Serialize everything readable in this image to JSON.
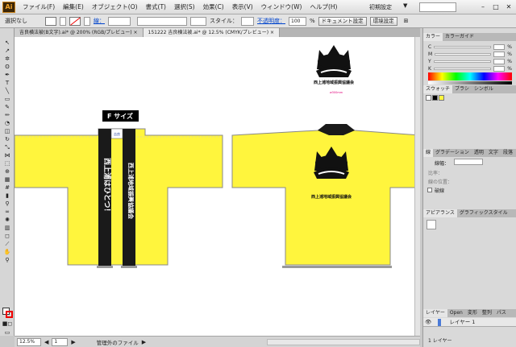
{
  "app": {
    "logo_text": "Ai"
  },
  "menu": {
    "items": [
      "ファイル(F)",
      "編集(E)",
      "オブジェクト(O)",
      "書式(T)",
      "選択(S)",
      "効果(C)",
      "表示(V)",
      "ウィンドウ(W)",
      "ヘルプ(H)"
    ],
    "workspace_label": "初期設定",
    "workspace_arrow": "▼"
  },
  "control": {
    "selection_label": "選択なし",
    "stroke_label": "線：",
    "style_label": "スタイル：",
    "opacity_label": "不透明度：",
    "opacity_value": "100",
    "opacity_unit": "%",
    "doc_setup_button": "ドキュメント設定",
    "prefs_button": "環境設定"
  },
  "tabs": [
    {
      "label": "吉良横法被(B文字).ai* @ 200% (RGB/プレビュー)",
      "close": "×"
    },
    {
      "label": "151222 吉良横法被.ai* @ 12.5% (CMYK/プレビュー)",
      "close": "×"
    }
  ],
  "artwork": {
    "logo_caption": "西上浦地域振興協議会",
    "size_note": "w300mm",
    "size_badge": "F サイズ",
    "collar_left_text": "西上浦はひとつ！",
    "collar_right_text": "西上浦地域振興協議会",
    "collar_tag": "吉良"
  },
  "status": {
    "zoom": "12.5%",
    "page": "1",
    "info": "管理外のファイル"
  },
  "panels": {
    "color_tabs": [
      "カラー",
      "カラーガイド"
    ],
    "color_channels": [
      "C",
      "M",
      "Y",
      "K"
    ],
    "color_unit": "%",
    "swatch_tabs": [
      "スウォッチ",
      "ブラシ",
      "シンボル"
    ],
    "stroke_tabs": [
      "線",
      "グラデーション",
      "透明",
      "文字",
      "段落"
    ],
    "stroke_weight_label": "線幅：",
    "stroke_limit_label": "比率：",
    "stroke_align_label": "線の位置：",
    "dashed_label": "破線",
    "appearance_tabs": [
      "アピアランス",
      "グラフィックスタイル"
    ],
    "layer_tabs": [
      "レイヤー",
      "Open",
      "変形",
      "整列",
      "パス"
    ],
    "layer_name": "レイヤー 1",
    "layer_count": "1 レイヤー"
  },
  "colors": {
    "jacket_fill": "#fff53d",
    "collar": "#1a1a1a",
    "accent": "#e0007a"
  }
}
